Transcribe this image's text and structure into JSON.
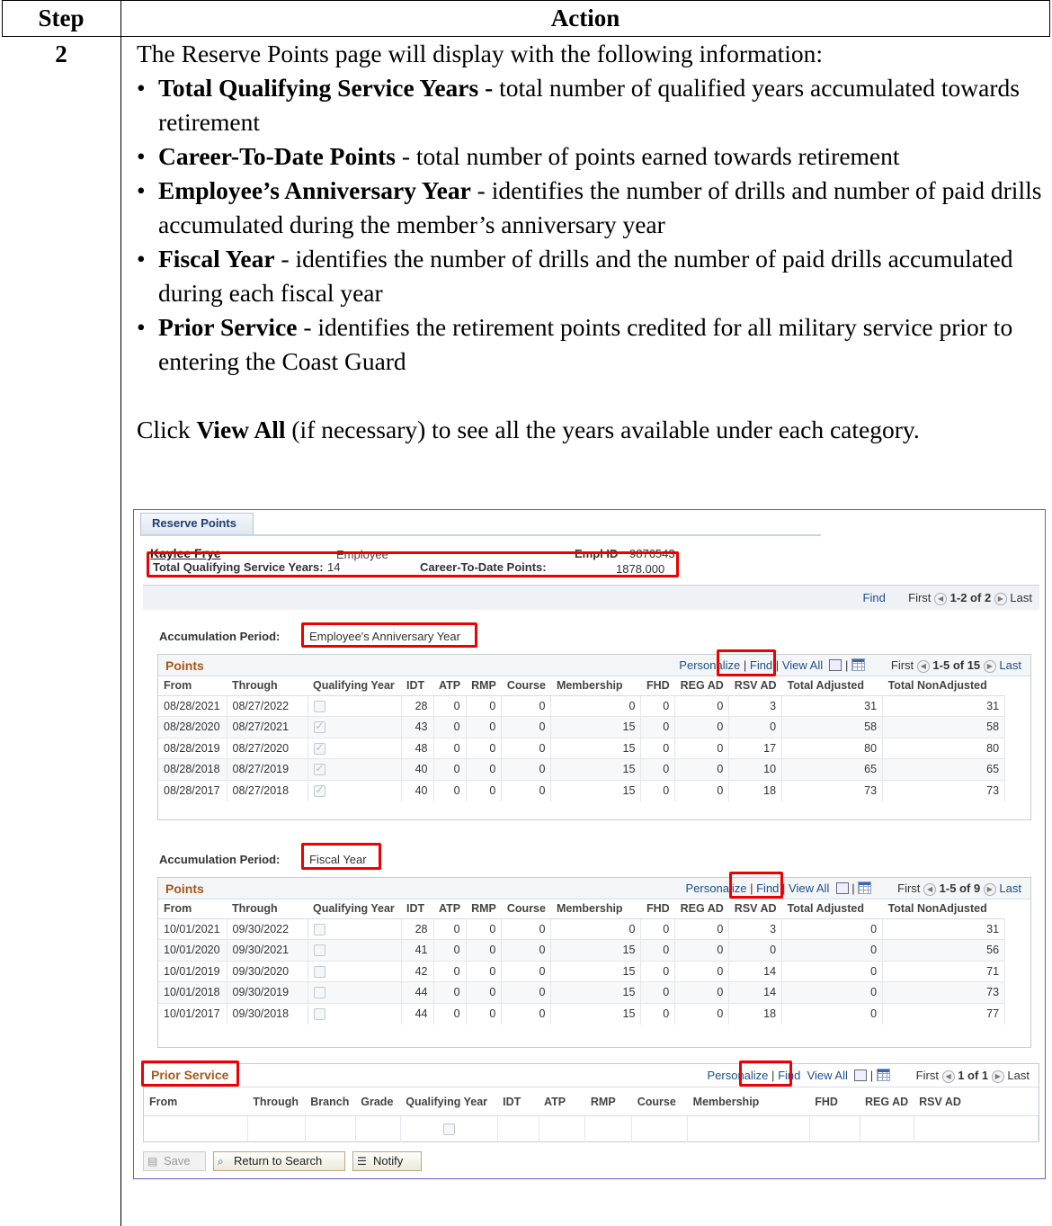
{
  "header": {
    "step": "Step",
    "action": "Action"
  },
  "row": {
    "step_number": "2",
    "intro": "The Reserve Points page will display with the following information:",
    "bullets": [
      {
        "term": "Total Qualifying Service Years -",
        "text": " total number of qualified years accumulated towards retirement"
      },
      {
        "term": "Career-To-Date Points",
        "text": " - total number of points earned towards retirement"
      },
      {
        "term": "Employee’s Anniversary Year",
        "text": " - identifies the number of drills and number of paid drills accumulated during the member’s anniversary year"
      },
      {
        "term": "Fiscal Year",
        "text": " - identifies the number of drills and the number of paid drills accumulated during each fiscal year"
      },
      {
        "term": "Prior Service",
        "text": " - identifies the retirement points credited for all military service prior to entering the Coast Guard"
      }
    ],
    "click_pre": "Click ",
    "click_bold": "View All",
    "click_post": " (if necessary) to see all the years available under each category."
  },
  "screenshot": {
    "tab": "Reserve Points",
    "employee_name": "Kaylee Frye",
    "employee_label": "Employee",
    "empl_id_label": "Empl ID",
    "empl_id": "9876543",
    "tqsy_label": "Total Qualifying Service Years:",
    "tqsy_value": "14",
    "ctd_label": "Career-To-Date Points:",
    "ctd_value": "1878.000",
    "outer_nav": {
      "find": "Find",
      "first": "First",
      "range": "1-2 of 2",
      "last": "Last"
    },
    "accum_label": "Accumulation Period:",
    "columns": [
      "From",
      "Through",
      "Qualifying Year",
      "IDT",
      "ATP",
      "RMP",
      "Course",
      "Membership",
      "FHD",
      "REG AD",
      "RSV AD",
      "Total Adjusted",
      "Total NonAdjusted"
    ],
    "anniversary": {
      "period": "Employee's Anniversary Year",
      "title": "Points",
      "personalize": "Personalize",
      "find": "Find",
      "view_all": "View All",
      "first": "First",
      "range": "1-5 of 15",
      "last": "Last",
      "rows": [
        [
          "08/28/2021",
          "08/27/2022",
          false,
          "28",
          "0",
          "0",
          "0",
          "0",
          "0",
          "0",
          "3",
          "31",
          "31"
        ],
        [
          "08/28/2020",
          "08/27/2021",
          true,
          "43",
          "0",
          "0",
          "0",
          "15",
          "0",
          "0",
          "0",
          "58",
          "58"
        ],
        [
          "08/28/2019",
          "08/27/2020",
          true,
          "48",
          "0",
          "0",
          "0",
          "15",
          "0",
          "0",
          "17",
          "80",
          "80"
        ],
        [
          "08/28/2018",
          "08/27/2019",
          true,
          "40",
          "0",
          "0",
          "0",
          "15",
          "0",
          "0",
          "10",
          "65",
          "65"
        ],
        [
          "08/28/2017",
          "08/27/2018",
          true,
          "40",
          "0",
          "0",
          "0",
          "15",
          "0",
          "0",
          "18",
          "73",
          "73"
        ]
      ]
    },
    "fiscal": {
      "period": "Fiscal Year",
      "title": "Points",
      "personalize": "Personalize",
      "find": "Find",
      "view_all": "View All",
      "first": "First",
      "range": "1-5 of 9",
      "last": "Last",
      "rows": [
        [
          "10/01/2021",
          "09/30/2022",
          false,
          "28",
          "0",
          "0",
          "0",
          "0",
          "0",
          "0",
          "3",
          "0",
          "31"
        ],
        [
          "10/01/2020",
          "09/30/2021",
          false,
          "41",
          "0",
          "0",
          "0",
          "15",
          "0",
          "0",
          "0",
          "0",
          "56"
        ],
        [
          "10/01/2019",
          "09/30/2020",
          false,
          "42",
          "0",
          "0",
          "0",
          "15",
          "0",
          "0",
          "14",
          "0",
          "71"
        ],
        [
          "10/01/2018",
          "09/30/2019",
          false,
          "44",
          "0",
          "0",
          "0",
          "15",
          "0",
          "0",
          "14",
          "0",
          "73"
        ],
        [
          "10/01/2017",
          "09/30/2018",
          false,
          "44",
          "0",
          "0",
          "0",
          "15",
          "0",
          "0",
          "18",
          "0",
          "77"
        ]
      ]
    },
    "prior": {
      "title": "Prior Service",
      "personalize": "Personalize",
      "find": "Find",
      "view_all": "View All",
      "first": "First",
      "range": "1 of 1",
      "last": "Last",
      "columns": [
        "From",
        "Through",
        "Branch",
        "Grade",
        "Qualifying Year",
        "IDT",
        "ATP",
        "RMP",
        "Course",
        "Membership",
        "FHD",
        "REG AD",
        "RSV AD"
      ]
    },
    "buttons": {
      "save": "Save",
      "return": "Return to Search",
      "notify": "Notify"
    },
    "sep": "|"
  }
}
